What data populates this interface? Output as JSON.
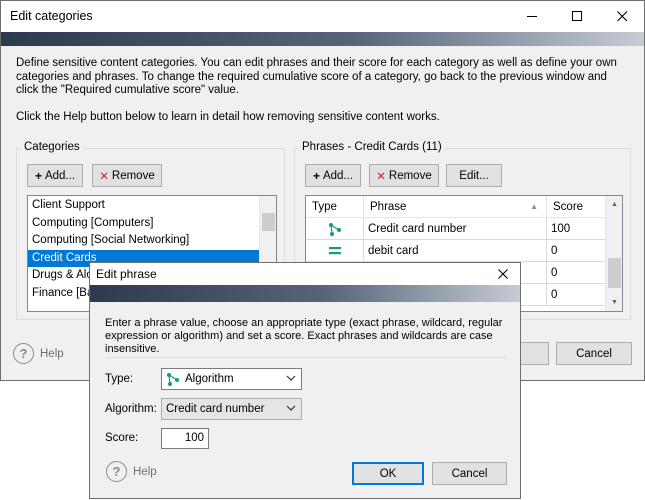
{
  "main_window": {
    "title": "Edit categories",
    "description": "Define sensitive content categories. You can edit phrases and their score for each category as well as define your own categories and phrases. To change the required cumulative score of a category, go back to the previous window and click the \"Required cumulative score\" value.",
    "help_text": "Click the Help button below to learn in detail how removing sensitive content works.",
    "categories_label": "Categories",
    "add_label": "Add...",
    "remove_label": "Remove",
    "categories": [
      "Client Support",
      "Computing [Computers]",
      "Computing [Social  Networking]",
      "Credit Cards",
      "Drugs & Alco",
      "Finance [Ba"
    ],
    "selected_category_index": 3,
    "phrases_label": "Phrases - Credit Cards (11)",
    "phrases_add_label": "Add...",
    "phrases_remove_label": "Remove",
    "phrases_edit_label": "Edit...",
    "columns": [
      "Type",
      "Phrase",
      "Score"
    ],
    "phrases": [
      {
        "type_icon": "algorithm-icon",
        "phrase": "Credit card number",
        "score": "100"
      },
      {
        "type_icon": "exact-phrase-icon",
        "phrase": "debit card",
        "score": "0"
      },
      {
        "type_icon": "",
        "phrase": "",
        "score": "0"
      },
      {
        "type_icon": "",
        "phrase": "",
        "score": "0"
      }
    ],
    "help_label": "Help",
    "cancel_label": "Cancel"
  },
  "dialog": {
    "title": "Edit phrase",
    "description": "Enter a phrase value, choose an appropriate type (exact phrase, wildcard, regular expression or algorithm) and set a score. Exact phrases and wildcards are case insensitive.",
    "type_label": "Type:",
    "type_value": "Algorithm",
    "algorithm_label": "Algorithm:",
    "algorithm_value": "Credit card number",
    "score_label": "Score:",
    "score_value": "100",
    "help_label": "Help",
    "ok_label": "OK",
    "cancel_label": "Cancel"
  },
  "colors": {
    "accent": "#0078d7",
    "icon_green": "#1a9a7a",
    "remove_red": "#d32020"
  }
}
